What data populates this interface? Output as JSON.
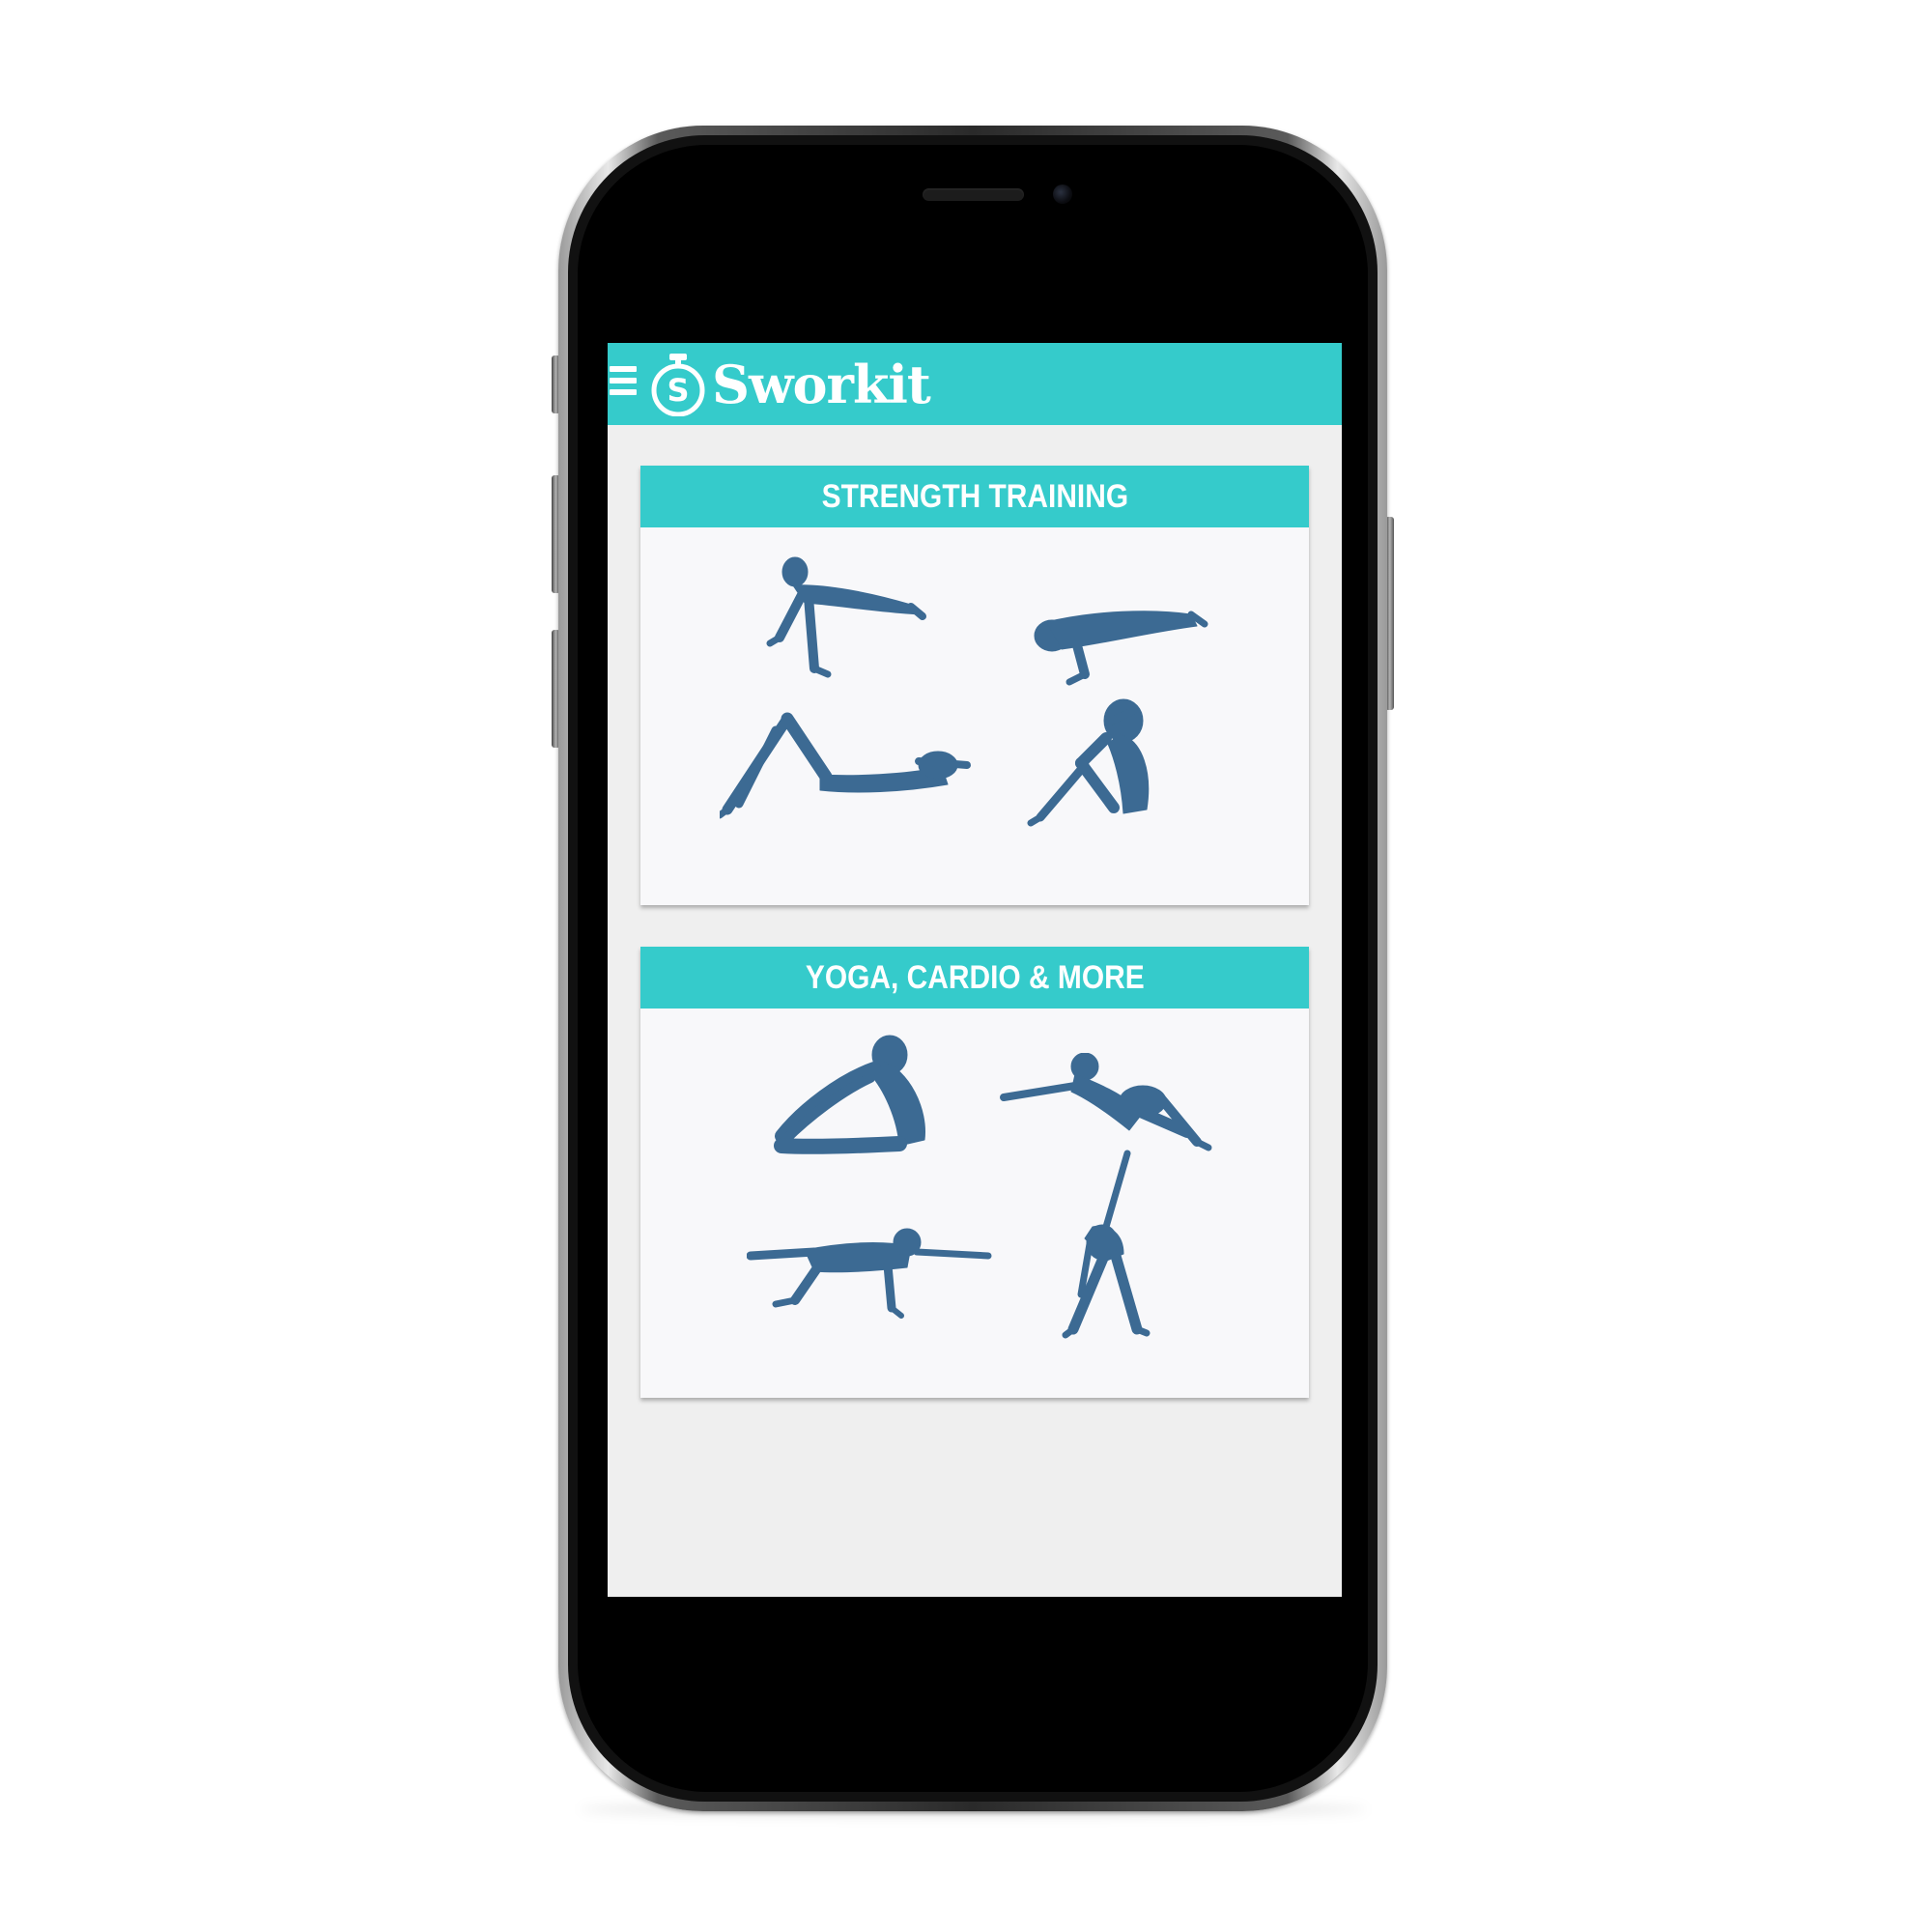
{
  "app": {
    "brand_name": "Sworkit",
    "logo_letter": "S"
  },
  "cards": [
    {
      "title": "STRENGTH TRAINING",
      "figures": [
        "pushup-figure",
        "low-plank-figure",
        "crunch-figure",
        "sit-up-figure"
      ]
    },
    {
      "title": "YOGA, CARDIO & MORE",
      "figures": [
        "forward-fold-figure",
        "reclined-twist-figure",
        "bird-dog-figure",
        "triangle-pose-figure"
      ]
    }
  ],
  "colors": {
    "accent": "#35cbcb",
    "figure": "#3c6a93",
    "screen_background": "#efefef",
    "card_background": "#f8f8fa"
  }
}
